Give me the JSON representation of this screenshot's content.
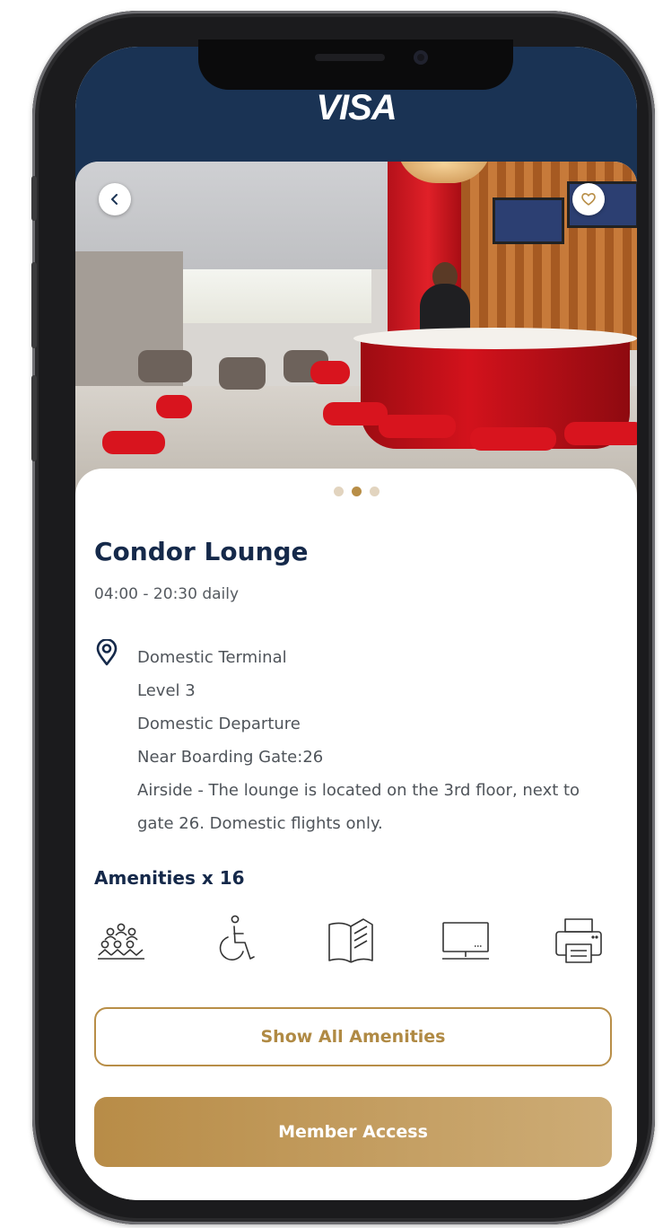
{
  "header": {
    "logo_text": "VISA",
    "background": "#1a3354"
  },
  "carousel": {
    "total": 3,
    "active_index": 1
  },
  "lounge": {
    "name": "Condor Lounge",
    "hours": "04:00 - 20:30 daily",
    "location_lines": [
      "Domestic Terminal",
      "Level 3",
      "Domestic Departure",
      "Near Boarding Gate:26",
      "Airside - The lounge is located on the 3rd floor, next to",
      "gate 26. Domestic flights only."
    ]
  },
  "amenities": {
    "title": "Amenities x 16",
    "icons": [
      "meeting-room-icon",
      "wheelchair-icon",
      "reading-material-icon",
      "tv-screen-icon",
      "printer-icon"
    ]
  },
  "buttons": {
    "show_all": "Show All Amenities",
    "member_access": "Member Access"
  },
  "colors": {
    "accent": "#b88e47",
    "navy": "#15294a",
    "header": "#1a3354"
  }
}
